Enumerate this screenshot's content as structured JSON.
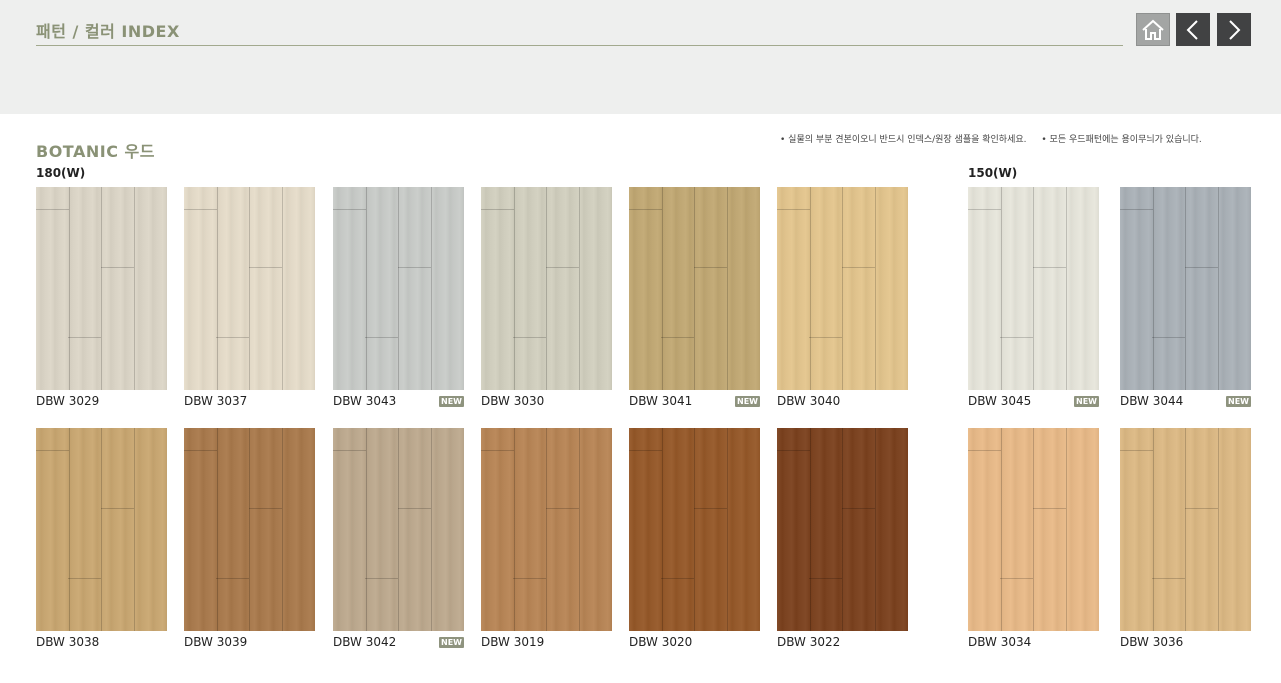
{
  "header": {
    "title": "패턴 / 컬러 INDEX",
    "home_icon": "home-icon",
    "prev_icon": "chevron-left-icon",
    "next_icon": "chevron-right-icon"
  },
  "section": {
    "title": "BOTANIC 우드",
    "notes": [
      "• 실물의 부분 견본이오니 반드시 인덱스/원장 샘플을 확인하세요.",
      "• 모든 우드패턴에는 용이무늬가 있습니다."
    ],
    "group_labels": [
      "180(W)",
      "150(W)"
    ]
  },
  "badge_label": "NEW",
  "swatches": [
    {
      "code": "DBW 3029",
      "is_new": false,
      "color": "#d9d3c5"
    },
    {
      "code": "DBW 3037",
      "is_new": false,
      "color": "#e2d9c7"
    },
    {
      "code": "DBW 3043",
      "is_new": true,
      "color": "#c6c9c6"
    },
    {
      "code": "DBW 3030",
      "is_new": false,
      "color": "#cfcdbd"
    },
    {
      "code": "DBW 3041",
      "is_new": true,
      "color": "#bfa774"
    },
    {
      "code": "DBW 3040",
      "is_new": false,
      "color": "#e0c38d"
    },
    {
      "code": "DBW 3045",
      "is_new": true,
      "color": "#e3e2d8"
    },
    {
      "code": "DBW 3044",
      "is_new": true,
      "color": "#a9b0b6"
    },
    {
      "code": "DBW 3038",
      "is_new": false,
      "color": "#c7a672"
    },
    {
      "code": "DBW 3039",
      "is_new": false,
      "color": "#a87a4e"
    },
    {
      "code": "DBW 3042",
      "is_new": true,
      "color": "#bba88e"
    },
    {
      "code": "DBW 3019",
      "is_new": false,
      "color": "#b68557"
    },
    {
      "code": "DBW 3020",
      "is_new": false,
      "color": "#955a2c"
    },
    {
      "code": "DBW 3022",
      "is_new": false,
      "color": "#7c4422"
    },
    {
      "code": "DBW 3034",
      "is_new": false,
      "color": "#e5b888"
    },
    {
      "code": "DBW 3036",
      "is_new": false,
      "color": "#d9b784"
    }
  ]
}
